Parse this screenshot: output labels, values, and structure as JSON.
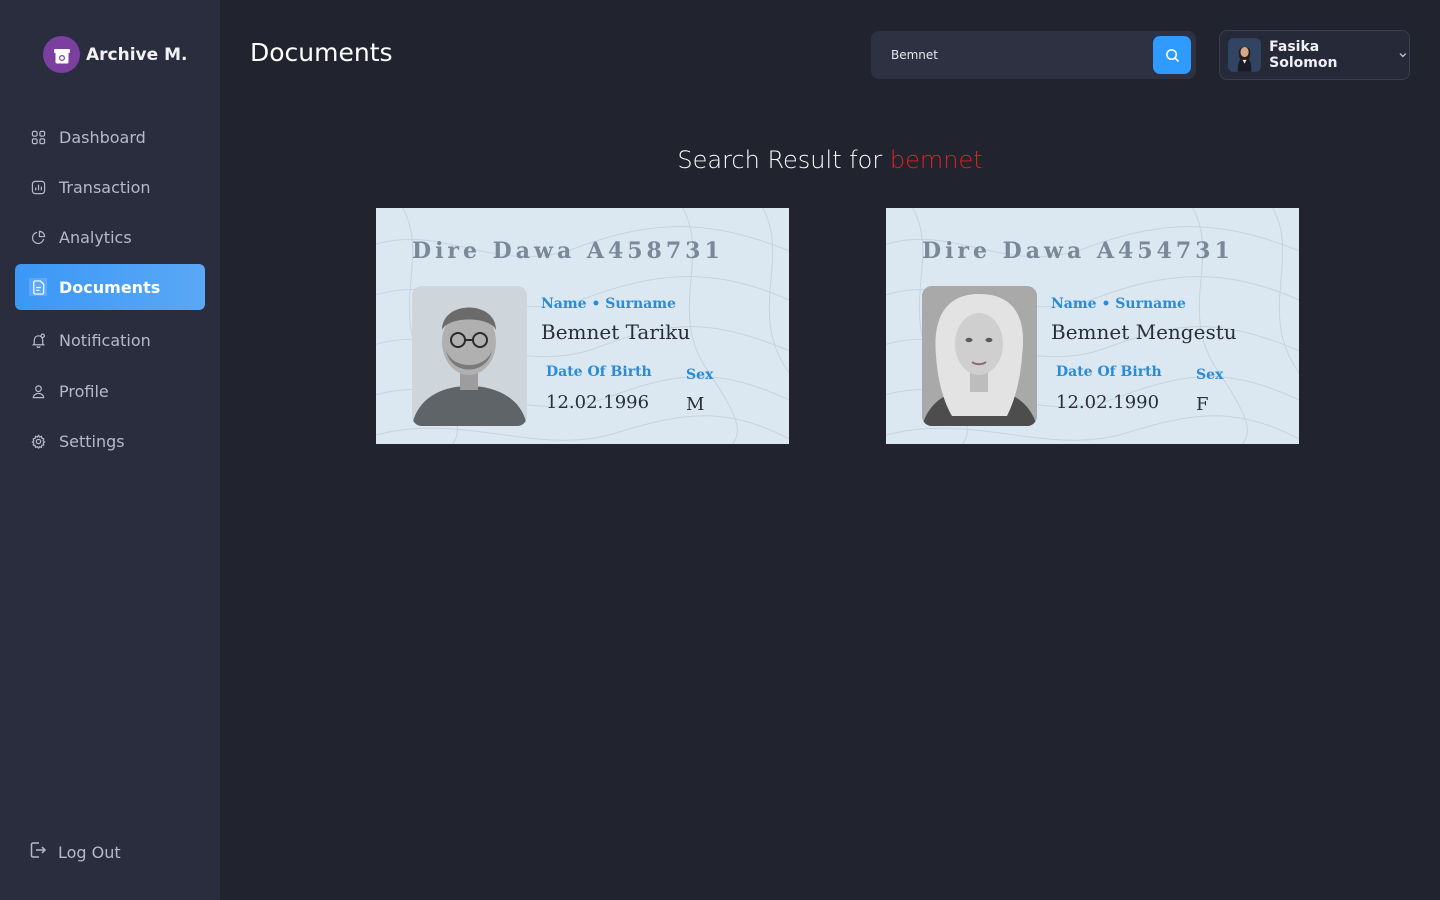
{
  "sidebar": {
    "brand": "Archive M.",
    "items": [
      {
        "label": "Dashboard",
        "icon": "grid-icon",
        "active": false
      },
      {
        "label": "Transaction",
        "icon": "chart-icon",
        "active": false
      },
      {
        "label": "Analytics",
        "icon": "pie-icon",
        "active": false
      },
      {
        "label": "Documents",
        "icon": "document-icon",
        "active": true
      },
      {
        "label": "Notification",
        "icon": "bell-icon",
        "active": false
      },
      {
        "label": "Profile",
        "icon": "user-icon",
        "active": false
      },
      {
        "label": "Settings",
        "icon": "gear-icon",
        "active": false
      }
    ],
    "logout": "Log Out"
  },
  "header": {
    "title": "Documents",
    "search_value": "Bemnet",
    "user_name": "Fasika Solomon"
  },
  "results": {
    "prefix": "Search Result for ",
    "query": "bemnet",
    "cards": [
      {
        "title": "Dire Dawa  A458731",
        "name_label": "Name • Surname",
        "name": "Bemnet Tariku",
        "dob_label": "Date Of Birth",
        "dob": "12.02.1996",
        "sex_label": "Sex",
        "sex": "M"
      },
      {
        "title": "Dire Dawa  A454731",
        "name_label": "Name • Surname",
        "name": "Bemnet Mengestu",
        "dob_label": "Date Of Birth",
        "dob": "12.02.1990",
        "sex_label": "Sex",
        "sex": "F"
      }
    ]
  },
  "colors": {
    "accent": "#2f9bff",
    "query_highlight": "#e2201c",
    "card_label": "#2a8bd8"
  }
}
